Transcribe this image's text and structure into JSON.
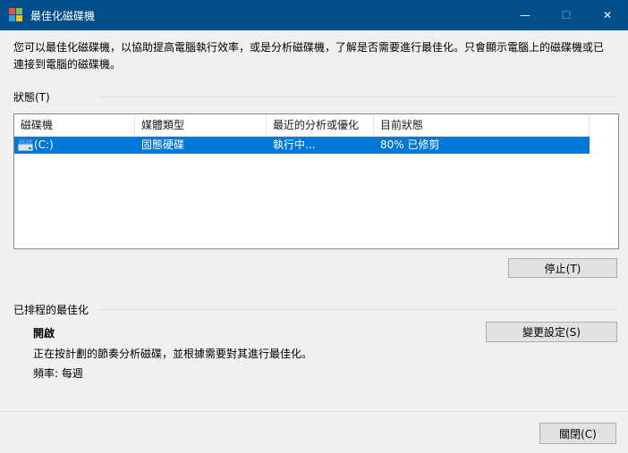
{
  "window": {
    "title": "最佳化磁碟機",
    "minimize_glyph": "—",
    "maximize_glyph": "☐",
    "close_glyph": "✕"
  },
  "description": "您可以最佳化磁碟機，以協助提高電腦執行效率，或是分析磁碟機，了解是否需要進行最佳化。只會顯示電腦上的磁碟機或已連接到電腦的磁碟機。",
  "status": {
    "heading": "狀態(T)",
    "columns": [
      "磁碟機",
      "媒體類型",
      "最近的分析或優化",
      "目前狀態"
    ],
    "rows": [
      {
        "drive": "(C:)",
        "media_type": "固態硬碟",
        "last_run": "執行中...",
        "current_status": "80% 已修剪",
        "icon": "drive-icon"
      }
    ],
    "stop_button": "停止(T)"
  },
  "scheduled": {
    "heading": "已排程的最佳化",
    "state": "開啟",
    "detail": "正在按計劃的節奏分析磁碟，並根據需要對其進行最佳化。",
    "frequency": "頻率: 每週",
    "change_settings_button": "變更設定(S)"
  },
  "footer": {
    "close_button": "關閉(C)"
  },
  "colors": {
    "titlebar": "#004e8c",
    "selection": "#0078d7"
  }
}
